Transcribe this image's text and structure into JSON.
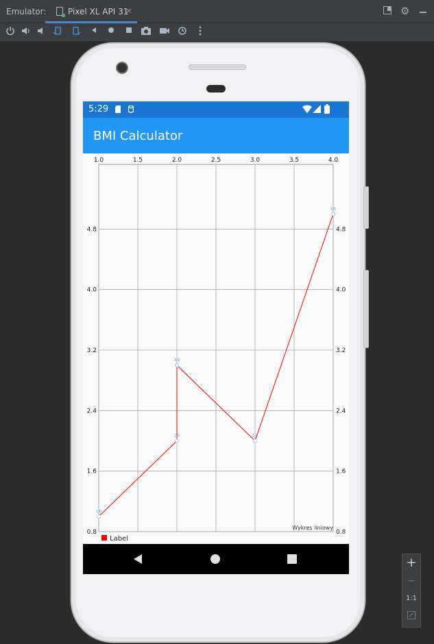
{
  "emulator": {
    "label": "Emulator:",
    "tab_title": "Pixel XL API 31",
    "tab_close": "✕"
  },
  "toolbar": {
    "icons": [
      "power-icon",
      "volume-up-icon",
      "volume-down-icon",
      "rotate-left-icon",
      "rotate-right-icon",
      "back-icon",
      "home-icon",
      "overview-icon",
      "screenshot-icon",
      "record-icon",
      "snapshot-icon",
      "more-icon"
    ]
  },
  "device": {
    "status_time": "5:29",
    "app_title": "BMI Calculator"
  },
  "zoom_controls": {
    "zoom_in": "+",
    "zoom_out": "−",
    "actual_size": "1:1"
  },
  "chart_data": {
    "type": "line",
    "x": [
      1.0,
      2.0,
      2.0,
      3.0,
      4.0
    ],
    "series": [
      {
        "name": "Label",
        "values": [
          1.0,
          2.0,
          3.0,
          2.0,
          5.0
        ]
      }
    ],
    "x_ticks": [
      "1.0",
      "1.5",
      "2.0",
      "2.5",
      "3.0",
      "3.5",
      "4.0"
    ],
    "y_ticks": [
      "0.8",
      "1.6",
      "2.4",
      "3.2",
      "4.0",
      "4.8"
    ],
    "point_labels": [
      "1.0",
      "2.0",
      "3.0",
      "2.0",
      "5.0"
    ],
    "xlim": [
      1.0,
      4.0
    ],
    "ylim": [
      0.8,
      5.6
    ],
    "x_axis_position": "top",
    "y_axis": "left and right",
    "grid": true,
    "legend": "bottom-left",
    "description": "Wykres liniowy",
    "line_color": "#ff0000",
    "point_color": "#2196f3"
  }
}
